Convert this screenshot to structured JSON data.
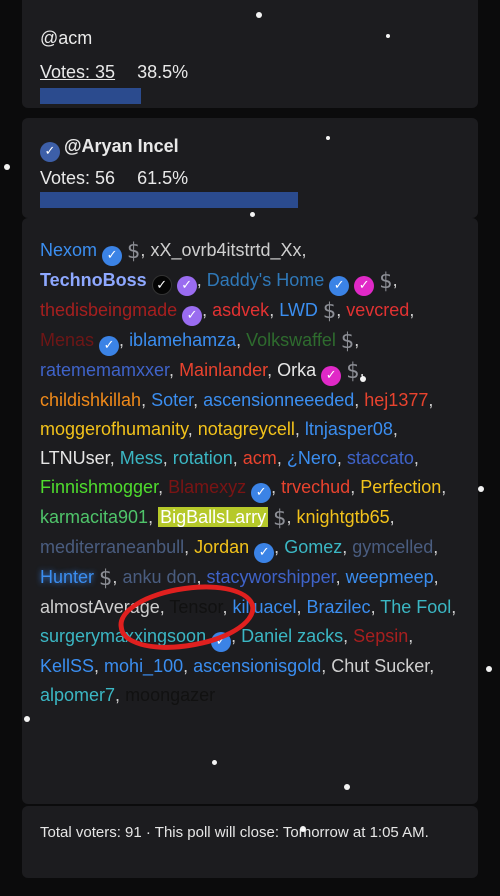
{
  "poll": {
    "option1": {
      "name": "@acm",
      "votes_label": "Votes: 35",
      "percent": "38.5%",
      "fraction": 0.385
    },
    "option2": {
      "name": "@Aryan Incel",
      "votes_label": "Votes: 56",
      "percent": "61.5%",
      "fraction": 0.615
    },
    "voters": [
      {
        "name": "Nexom",
        "color": "#3b8ef0",
        "badges": [
          "check",
          "dollar"
        ]
      },
      {
        "name": "xX_ovrb4itstrtd_Xx",
        "color": "#cfcfcf",
        "badges": []
      },
      {
        "name": "TechnoBoss",
        "color": "#8ea8ff",
        "badges": [
          "check-black",
          "check-purple"
        ]
      },
      {
        "name": "Daddy's Home",
        "color": "#2f78b8",
        "badges": [
          "check",
          "check-magenta",
          "dollar"
        ]
      },
      {
        "name": "thedisbeingmade",
        "color": "#a61f1f",
        "badges": [
          "check-purple"
        ]
      },
      {
        "name": "asdvek",
        "color": "#e23232",
        "badges": []
      },
      {
        "name": "LWD",
        "color": "#3b8ef0",
        "badges": [
          "dollar"
        ]
      },
      {
        "name": "vevcred",
        "color": "#e23232",
        "badges": []
      },
      {
        "name": "Menas",
        "color": "#6e1616",
        "badges": [
          "check"
        ]
      },
      {
        "name": "iblamehamza",
        "color": "#3b8ef0",
        "badges": []
      },
      {
        "name": "Volkswaffel",
        "color": "#2e6b2e",
        "badges": [
          "dollar"
        ]
      },
      {
        "name": "ratememamxxer",
        "color": "#3f63c9",
        "badges": []
      },
      {
        "name": "Mainlander",
        "color": "#e8432e",
        "badges": []
      },
      {
        "name": "Orka",
        "color": "#e6e6e6",
        "badges": [
          "check-magenta",
          "dollar"
        ]
      },
      {
        "name": "childishkillah",
        "color": "#f08a1a",
        "badges": []
      },
      {
        "name": "Soter",
        "color": "#3b8ef0",
        "badges": []
      },
      {
        "name": "ascensionneeeded",
        "color": "#3b8ef0",
        "badges": []
      },
      {
        "name": "hej1377",
        "color": "#e8432e",
        "badges": []
      },
      {
        "name": "moggerofhumanity",
        "color": "#f2c21b",
        "badges": []
      },
      {
        "name": "notagreycell",
        "color": "#f2c21b",
        "badges": []
      },
      {
        "name": "ltnjasper08",
        "color": "#3b8ef0",
        "badges": []
      },
      {
        "name": "LTNUser",
        "color": "#e6e6e6",
        "badges": []
      },
      {
        "name": "Mess",
        "color": "#3bb7c4",
        "badges": []
      },
      {
        "name": "rotation",
        "color": "#3bb7c4",
        "badges": []
      },
      {
        "name": "acm",
        "color": "#e8432e",
        "badges": []
      },
      {
        "name": "¿Nero",
        "color": "#3b8ef0",
        "badges": []
      },
      {
        "name": "staccato",
        "color": "#3f63c9",
        "badges": []
      },
      {
        "name": "Finnishmogger",
        "color": "#4fdc2e",
        "badges": []
      },
      {
        "name": "Blamexyz",
        "color": "#7a1414",
        "badges": [
          "check"
        ]
      },
      {
        "name": "trvechud",
        "color": "#e8432e",
        "badges": []
      },
      {
        "name": "Perfection",
        "color": "#f2c21b",
        "badges": []
      },
      {
        "name": "karmacita901",
        "color": "#4fc46a",
        "badges": []
      },
      {
        "name": "BigBallsLarry",
        "color": "#ffffff",
        "badges": [
          "dollar"
        ],
        "highlight": true
      },
      {
        "name": "knightgtb65",
        "color": "#f2c21b",
        "badges": []
      },
      {
        "name": "mediterraneanbull",
        "color": "#4a5d80",
        "badges": []
      },
      {
        "name": "Jordan",
        "color": "#f2c21b",
        "badges": [
          "check"
        ]
      },
      {
        "name": "Gomez",
        "color": "#3bb7c4",
        "badges": []
      },
      {
        "name": "gymcelled",
        "color": "#4a5d80",
        "badges": []
      },
      {
        "name": "Hunter",
        "color": "#3b8ef0",
        "badges": [
          "dollar"
        ],
        "glow": true
      },
      {
        "name": "anku don",
        "color": "#4a5d80",
        "badges": []
      },
      {
        "name": "stacyworshipper",
        "color": "#3f63c9",
        "badges": []
      },
      {
        "name": "weepmeep",
        "color": "#3b8ef0",
        "badges": []
      },
      {
        "name": "almostAverage",
        "color": "#cfcfcf",
        "badges": []
      },
      {
        "name": "Tensor",
        "color": "#111111",
        "badges": []
      },
      {
        "name": "killuacel",
        "color": "#3b8ef0",
        "badges": []
      },
      {
        "name": "Brazilec",
        "color": "#3b8ef0",
        "badges": []
      },
      {
        "name": "The Fool",
        "color": "#3bb7c4",
        "badges": []
      },
      {
        "name": "surgerymaxxingsoon",
        "color": "#3bb7c4",
        "badges": [
          "check"
        ]
      },
      {
        "name": "Daniel zacks",
        "color": "#3bb7c4",
        "badges": []
      },
      {
        "name": "Sepsin",
        "color": "#a61f1f",
        "badges": []
      },
      {
        "name": "KellSS",
        "color": "#3b8ef0",
        "badges": []
      },
      {
        "name": "mohi_100",
        "color": "#3b8ef0",
        "badges": []
      },
      {
        "name": "ascensionisgold",
        "color": "#3b8ef0",
        "badges": []
      },
      {
        "name": "Chut Sucker",
        "color": "#cfcfcf",
        "badges": []
      },
      {
        "name": "alpomer7",
        "color": "#3bb7c4",
        "badges": []
      },
      {
        "name": "moongazer",
        "color": "#111111",
        "badges": []
      }
    ],
    "dollar_glyph": "$",
    "check_glyph": "✓",
    "footer": "Total voters: 91 · This poll will close: Tomorrow at 1:05 AM."
  },
  "colors": {
    "bar": "#2b4b8e",
    "card": "#1c1c1f",
    "annotation": "#e0201f"
  }
}
